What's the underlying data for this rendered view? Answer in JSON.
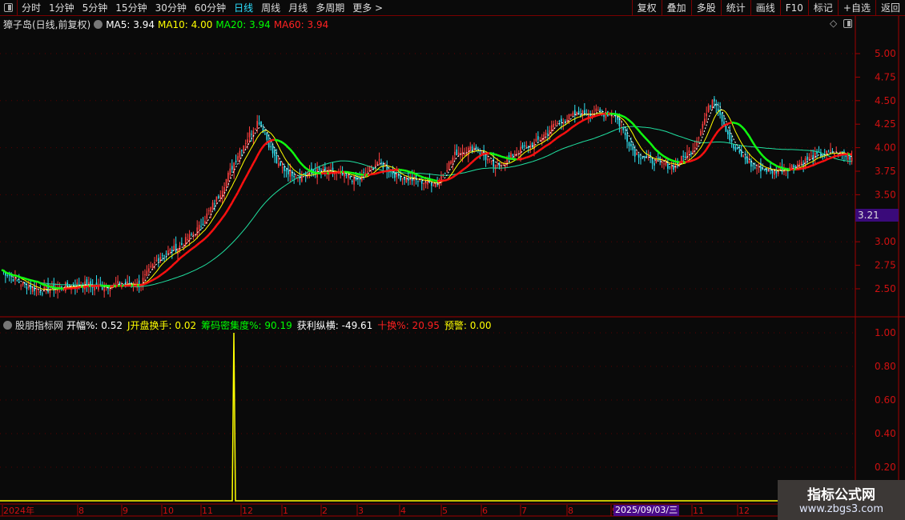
{
  "toolbar": {
    "periods": [
      "分时",
      "1分钟",
      "5分钟",
      "15分钟",
      "30分钟",
      "60分钟",
      "日线",
      "周线",
      "月线",
      "多周期",
      "更多 >"
    ],
    "active": "日线",
    "right_buttons": [
      "复权",
      "叠加",
      "多股",
      "统计",
      "画线",
      "F10",
      "标记",
      "+自选",
      "返回"
    ]
  },
  "main_legend": {
    "title": "獐子岛(日线,前复权)",
    "ma5": "MA5: 3.94",
    "ma10": "MA10: 4.00",
    "ma20": "MA20: 3.94",
    "ma60": "MA60: 3.94"
  },
  "price_axis": {
    "ticks": [
      "5.00",
      "4.75",
      "4.50",
      "4.25",
      "4.00",
      "3.75",
      "3.50",
      "3.00",
      "2.75",
      "2.50"
    ],
    "last_price": "3.21"
  },
  "indicator_legend": {
    "title": "股朋指标网",
    "items": [
      {
        "label": "开幅%: 0.52",
        "color": "#ffffff"
      },
      {
        "label": "J开盘换手: 0.02",
        "color": "#ffff00"
      },
      {
        "label": "筹码密集度%: 90.19",
        "color": "#00ff00"
      },
      {
        "label": "获利纵横: -49.61",
        "color": "#ffffff"
      },
      {
        "label": "十换%: 20.95",
        "color": "#ff2020"
      },
      {
        "label": "预警: 0.00",
        "color": "#ffff00"
      }
    ]
  },
  "indicator_axis": {
    "ticks": [
      "1.00",
      "0.80",
      "0.60",
      "0.40",
      "0.20"
    ]
  },
  "date_axis": {
    "labels": [
      "2024年",
      "8",
      "9",
      "10",
      "11",
      "12",
      "1",
      "2",
      "3",
      "4",
      "5",
      "6",
      "7",
      "8",
      "9",
      "11",
      "12"
    ],
    "cursor_date": "2025/09/03/三"
  },
  "watermark": {
    "title": "指标公式网",
    "url": "www.zbgs3.com"
  },
  "colors": {
    "up": "#ff4040",
    "down": "#30e0f0",
    "ma5": "#ffffff",
    "ma10": "#ffff00",
    "ma20_up": "#ff1010",
    "ma20_down": "#10ff10",
    "ma60": "#20e0a0",
    "axis": "#d01010"
  },
  "chart_data": {
    "type": "candlestick",
    "price_range": [
      2.35,
      5.35
    ],
    "close_keypoints": [
      2.7,
      2.55,
      2.48,
      2.52,
      2.55,
      2.52,
      2.55,
      2.55,
      2.85,
      2.95,
      3.15,
      3.5,
      3.95,
      4.3,
      3.8,
      3.7,
      3.75,
      3.72,
      3.65,
      3.85,
      3.7,
      3.65,
      3.62,
      3.95,
      4.0,
      3.78,
      3.95,
      4.05,
      4.25,
      4.35,
      4.38,
      4.35,
      3.95,
      3.85,
      3.8,
      4.0,
      4.55,
      4.0,
      3.8,
      3.75,
      3.8,
      3.9,
      3.95,
      3.9
    ],
    "indicator": {
      "range": [
        0,
        1.05
      ],
      "spike_value": 1.0
    }
  }
}
